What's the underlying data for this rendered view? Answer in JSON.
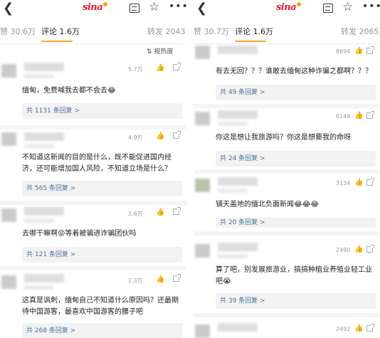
{
  "left": {
    "logo": "sina",
    "tabs": {
      "likes": "赞 30.6万",
      "comments": "评论 1.6万",
      "reposts": "转发 2043"
    },
    "sort_label": "按热度",
    "comments": [
      {
        "likes": "5.7万",
        "text": "缅甸，免费喊我去都不会去😂",
        "replies": "共 1131 条回复 >"
      },
      {
        "likes": "4.9万",
        "text": "不知道这新闻的目的是什么，既不能促进国内经济，还可能增加国人风险，不知道立场是什么？",
        "replies": "共 565 条回复 >"
      },
      {
        "likes": "2.6万",
        "text": "去哪干嘛啊😝等着被骗进诈骗团伙吗",
        "replies": "共 121 条回复 >"
      },
      {
        "likes": "2.3万",
        "text": "这真是讽刺，缅甸自己不知道什么原因吗？还最期待中国游客，最喜欢中国游客的腰子吧",
        "replies": "共 268 条回复 >"
      }
    ]
  },
  "right": {
    "logo": "sina",
    "tabs": {
      "likes": "赞 30.7万",
      "comments": "评论 1.6万",
      "reposts": "转发 2065"
    },
    "comments": [
      {
        "likes": "8694",
        "text": "有去无回？？？谁敢去缅甸这种诈骗之都啊？？？",
        "replies": "共 49 条回复 >"
      },
      {
        "likes": "6144",
        "text": "你这是想让我旅游吗？你这是想要我的命呀",
        "replies": "共 24 条回复 >"
      },
      {
        "likes": "3134",
        "text": "铺天盖地的缅北负面新闻😂😂😂",
        "replies": "共 20 条回复 >"
      },
      {
        "likes": "2490",
        "text": "算了吧，别发展旅游业，搞搞种植业养殖业轻工业吧😭",
        "replies": "共 39 条回复 >"
      },
      {
        "likes": "2492",
        "text": "",
        "replies": ""
      }
    ]
  },
  "icons": {
    "back": "back-arrow-icon",
    "table": "table-icon",
    "star": "star-icon",
    "more": "more-icon",
    "sort": "sort-icon",
    "thumb": "thumbs-up-icon",
    "share": "share-icon"
  },
  "colors": {
    "accent": "#f5a623",
    "link": "#4a6fa1",
    "brand": "#e6162d"
  }
}
